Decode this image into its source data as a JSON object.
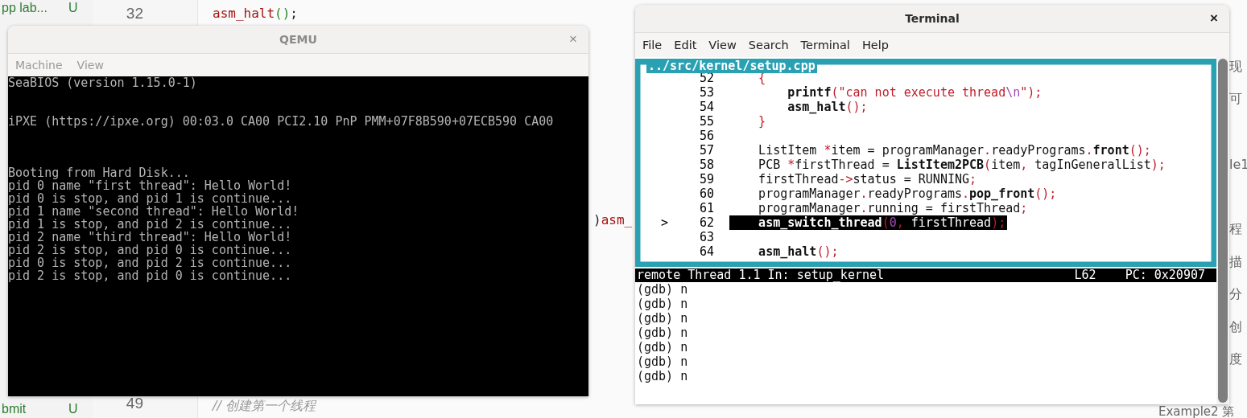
{
  "background_editor": {
    "sidebar": {
      "items": [
        {
          "label": "pp lab...",
          "status": "U"
        },
        {
          "label": "bmit",
          "status": "U"
        }
      ]
    },
    "lines": [
      {
        "number": "32",
        "code": [
          {
            "kind": "func",
            "text": "asm_halt"
          },
          {
            "kind": "paren",
            "text": "()"
          },
          {
            "kind": "plain",
            "text": ";"
          }
        ]
      },
      {
        "code": [
          {
            "kind": "plain",
            "text": ")"
          },
          {
            "kind": "func",
            "text": "asm_"
          }
        ]
      },
      {
        "number": "49",
        "code": [
          {
            "kind": "comment",
            "text": "// 创建第一个线程"
          }
        ]
      }
    ],
    "side_panel": [
      "现",
      "可",
      "le1",
      "程",
      "描",
      "分",
      "创",
      "度",
      "Example2 第"
    ]
  },
  "qemu": {
    "title": "QEMU",
    "close": "×",
    "menu": [
      "Machine",
      "View"
    ],
    "screen": [
      [
        "SeaBIOS (version 1.15.0-1)"
      ],
      [
        "iPXE (https://ipxe.org) 00:03.0 CA00 PCI2.10 PnP PMM+07F8B590+07ECB590 CA00"
      ],
      [
        "Booting from Hard Disk...",
        "pid 0 name \"first thread\": Hello World!",
        "pid 0 is stop, and pid 1 is continue...",
        "pid 1 name \"second thread\": Hello World!",
        "pid 1 is stop, and pid 2 is continue...",
        "pid 2 name \"third thread\": Hello World!",
        "pid 2 is stop, and pid 0 is continue...",
        "pid 0 is stop, and pid 2 is continue...",
        "pid 2 is stop, and pid 0 is continue..."
      ]
    ]
  },
  "terminal": {
    "title": "Terminal",
    "close": "×",
    "menu": [
      "File",
      "Edit",
      "View",
      "Search",
      "Terminal",
      "Help"
    ],
    "source": {
      "file": "../src/kernel/setup.cpp",
      "lines": [
        {
          "number": "52",
          "current": false,
          "code": [
            {
              "kind": "punct",
              "text": "    {"
            }
          ]
        },
        {
          "number": "53",
          "current": false,
          "code": [
            {
              "kind": "bold",
              "text": "        printf"
            },
            {
              "kind": "punct",
              "text": "(\"can not execute thread"
            },
            {
              "kind": "escape",
              "text": "\\n"
            },
            {
              "kind": "punct",
              "text": "\");"
            }
          ]
        },
        {
          "number": "54",
          "current": false,
          "code": [
            {
              "kind": "bold",
              "text": "        asm_halt"
            },
            {
              "kind": "punct",
              "text": "();"
            }
          ]
        },
        {
          "number": "55",
          "current": false,
          "code": [
            {
              "kind": "punct",
              "text": "    }"
            }
          ]
        },
        {
          "number": "56",
          "current": false
        },
        {
          "number": "57",
          "current": false,
          "code": [
            {
              "kind": "plain",
              "text": "    ListItem "
            },
            {
              "kind": "punct",
              "text": "*"
            },
            {
              "kind": "plain",
              "text": "item = programManager"
            },
            {
              "kind": "punct",
              "text": "."
            },
            {
              "kind": "plain",
              "text": "readyPrograms"
            },
            {
              "kind": "punct",
              "text": "."
            },
            {
              "kind": "bold",
              "text": "front"
            },
            {
              "kind": "punct",
              "text": "();"
            }
          ]
        },
        {
          "number": "58",
          "current": false,
          "code": [
            {
              "kind": "plain",
              "text": "    PCB "
            },
            {
              "kind": "punct",
              "text": "*"
            },
            {
              "kind": "plain",
              "text": "firstThread = "
            },
            {
              "kind": "bold",
              "text": "ListItem2PCB"
            },
            {
              "kind": "punct",
              "text": "("
            },
            {
              "kind": "plain",
              "text": "item"
            },
            {
              "kind": "punct",
              "text": ","
            },
            {
              "kind": "plain",
              "text": " tagInGeneralList"
            },
            {
              "kind": "punct",
              "text": ");"
            }
          ]
        },
        {
          "number": "59",
          "current": false,
          "code": [
            {
              "kind": "plain",
              "text": "    firstThread"
            },
            {
              "kind": "punct",
              "text": "->"
            },
            {
              "kind": "plain",
              "text": "status = RUNNING"
            },
            {
              "kind": "punct",
              "text": ";"
            }
          ]
        },
        {
          "number": "60",
          "current": false,
          "code": [
            {
              "kind": "plain",
              "text": "    programManager"
            },
            {
              "kind": "punct",
              "text": "."
            },
            {
              "kind": "plain",
              "text": "readyPrograms"
            },
            {
              "kind": "punct",
              "text": "."
            },
            {
              "kind": "bold",
              "text": "pop_front"
            },
            {
              "kind": "punct",
              "text": "();"
            }
          ]
        },
        {
          "number": "61",
          "current": false,
          "code": [
            {
              "kind": "plain",
              "text": "    programManager"
            },
            {
              "kind": "punct",
              "text": "."
            },
            {
              "kind": "plain",
              "text": "running = firstThread"
            },
            {
              "kind": "punct",
              "text": ";"
            }
          ]
        },
        {
          "number": "62",
          "current": true,
          "marker": ">",
          "code": [
            {
              "kind": "bold",
              "text": "    asm_switch_thread"
            },
            {
              "kind": "punct",
              "text": "("
            },
            {
              "kind": "number",
              "text": "0"
            },
            {
              "kind": "punct",
              "text": ","
            },
            {
              "kind": "plain",
              "text": " firstThread"
            },
            {
              "kind": "punct",
              "text": ");"
            }
          ]
        },
        {
          "number": "63",
          "current": false
        },
        {
          "number": "64",
          "current": false,
          "code": [
            {
              "kind": "bold",
              "text": "    asm_halt"
            },
            {
              "kind": "punct",
              "text": "();"
            }
          ]
        }
      ]
    },
    "status_line": {
      "left": "remote Thread 1.1 In: setup_kernel",
      "line": "L62",
      "pc": "PC: 0x20907"
    },
    "gdb_lines": [
      "(gdb) n",
      "(gdb) n",
      "(gdb) n",
      "(gdb) n",
      "(gdb) n",
      "(gdb) n",
      "(gdb) n"
    ]
  }
}
